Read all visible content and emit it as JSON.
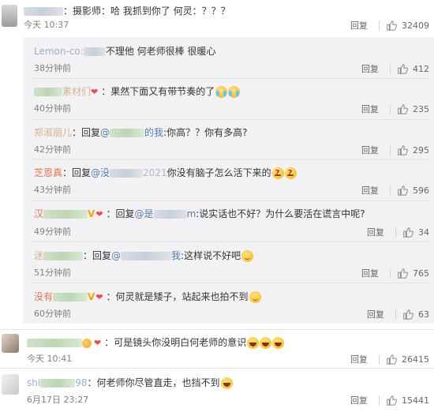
{
  "colors": {
    "name": "#eb7350",
    "link": "#507daf",
    "meta": "#808080",
    "block_bg": "#f2f2f5"
  },
  "icons": {
    "like": "thumbs-up-icon",
    "avatar": "avatar"
  },
  "reply_label": "回复",
  "comments": [
    {
      "author_suffix": "：",
      "text": "摄影师：哈 我抓到你了  何灵：？？？",
      "time": "今天 10:37",
      "likes": "32409"
    },
    {
      "author_visible": "Lemon-co:",
      "text": "不理他 何老师很棒 很暖心",
      "time": "38分钟前",
      "likes": "412"
    },
    {
      "author_visible": "素材们",
      "text": "：果然下面又有带节奏的了",
      "time": "40分钟前",
      "likes": "235"
    },
    {
      "author_visible": "郑淑丽儿",
      "reply_prefix": "：回复",
      "mention_start": "@",
      "mention_end": "的我",
      "text": ":你高？？你有多高?",
      "time": "42分钟前",
      "likes": "295"
    },
    {
      "author_visible": "芝恩真",
      "reply_prefix": "：回复",
      "mention_start": "@没",
      "mention_end": "2021",
      "text": "你没有脑子怎么活下来的",
      "time": "43分钟前",
      "likes": "596"
    },
    {
      "author_visible": "汉",
      "reply_prefix": "：回复",
      "mention_start": "@是",
      "mention_end": "m",
      "text": ":说实话也不好？为什么要活在谎言中呢?",
      "time": "49分钟前",
      "likes": "34"
    },
    {
      "author_visible": "迷",
      "reply_prefix": "：回复",
      "mention_start": "@",
      "mention_end": "我",
      "text": ":这样说不好吧",
      "time": "51分钟前",
      "likes": "765"
    },
    {
      "author_visible": "没有",
      "text": "：何灵就是矮子，站起来也拍不到",
      "time": "60分钟前",
      "likes": "63"
    },
    {
      "text": "：可是镜头你没明白何老师的意识",
      "time": "今天 10:41",
      "likes": "26415"
    },
    {
      "author_visible": "shi",
      "author_end": "98",
      "text": "：何老师你尽管直走，也挡不到",
      "time": "6月17日 23:27",
      "likes": "15441"
    }
  ]
}
